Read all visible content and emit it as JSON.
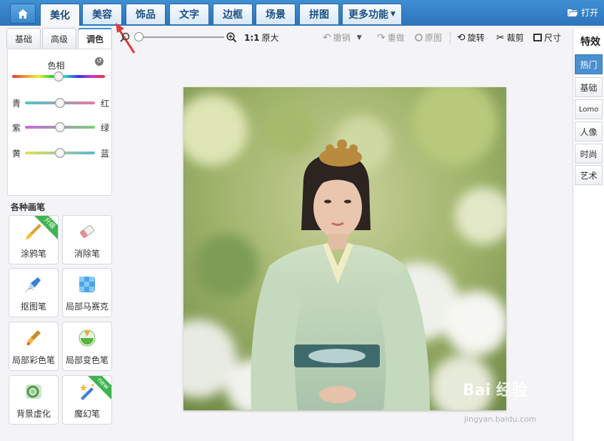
{
  "nav": {
    "tabs": [
      "美化",
      "美容",
      "饰品",
      "文字",
      "边框",
      "场景",
      "拼图",
      "更多功能"
    ],
    "active_tab": "美化",
    "open_label": "打开"
  },
  "left": {
    "subtabs": [
      "基础",
      "高级",
      "调色"
    ],
    "active_subtab": "调色",
    "hue_label": "色相",
    "sliders": [
      {
        "left": "青",
        "right": "红"
      },
      {
        "left": "紫",
        "right": "绿"
      },
      {
        "left": "黄",
        "right": "蓝"
      }
    ],
    "brushes_title": "各种画笔",
    "brushes": [
      {
        "label": "涂鸦笔",
        "icon": "paintbrush-icon",
        "badge": "升级"
      },
      {
        "label": "消除笔",
        "icon": "eraser-icon",
        "badge": ""
      },
      {
        "label": "抠图笔",
        "icon": "cutout-pen-icon",
        "badge": ""
      },
      {
        "label": "局部马赛克",
        "icon": "mosaic-icon",
        "badge": ""
      },
      {
        "label": "局部彩色笔",
        "icon": "color-brush-icon",
        "badge": ""
      },
      {
        "label": "局部变色笔",
        "icon": "color-change-icon",
        "badge": ""
      },
      {
        "label": "背景虚化",
        "icon": "blur-icon",
        "badge": ""
      },
      {
        "label": "魔幻笔",
        "icon": "magic-wand-icon",
        "badge": "new"
      }
    ]
  },
  "toolbar": {
    "ratio": "1:1",
    "original_size": "原大",
    "undo": "撤销",
    "redo": "重做",
    "original": "原图",
    "rotate": "旋转",
    "crop": "裁剪",
    "size": "尺寸"
  },
  "right": {
    "title": "特效",
    "items": [
      "热门",
      "基础",
      "Lomo",
      "人像",
      "时尚",
      "艺术"
    ],
    "active_item": "热门"
  },
  "watermark": {
    "main": "Bai 经验",
    "sub": "jingyan.baidu.com"
  },
  "colors": {
    "nav_blue": "#3f8fd3",
    "accent_red": "#e23a3a",
    "badge_green": "#3fb34f"
  }
}
